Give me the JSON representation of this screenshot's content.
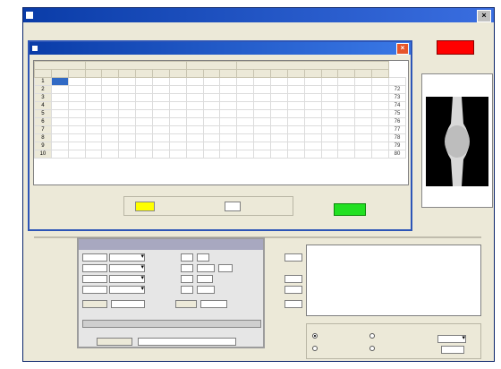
{
  "colors": {
    "title_bar": "#0a3ca8",
    "status_red": "#ff0000",
    "ok_green": "#22e022",
    "highlight_yellow": "#ffff00",
    "selection": "#316ac5"
  },
  "main_window": {
    "close_label": "×"
  },
  "dialog": {
    "close_label": "×",
    "headers": [
      "",
      "",
      "",
      "",
      "",
      "",
      "",
      "",
      "",
      "",
      "",
      "",
      "",
      "",
      "",
      "",
      "",
      "",
      "",
      "",
      ""
    ],
    "rows": [
      {
        "n": "1",
        "cells": [
          "",
          "",
          "",
          "",
          "",
          "",
          "",
          "",
          "",
          "",
          "",
          "",
          "",
          "",
          "",
          "",
          "",
          "",
          "",
          ""
        ],
        "last": ""
      },
      {
        "n": "2",
        "cells": [
          "",
          "",
          "",
          "",
          "",
          "",
          "",
          "",
          "",
          "",
          "",
          "",
          "",
          "",
          "",
          "",
          "",
          "",
          "",
          ""
        ],
        "last": "72"
      },
      {
        "n": "3",
        "cells": [
          "",
          "",
          "",
          "",
          "",
          "",
          "",
          "",
          "",
          "",
          "",
          "",
          "",
          "",
          "",
          "",
          "",
          "",
          "",
          ""
        ],
        "last": "73"
      },
      {
        "n": "4",
        "cells": [
          "",
          "",
          "",
          "",
          "",
          "",
          "",
          "",
          "",
          "",
          "",
          "",
          "",
          "",
          "",
          "",
          "",
          "",
          "",
          ""
        ],
        "last": "74"
      },
      {
        "n": "5",
        "cells": [
          "",
          "",
          "",
          "",
          "",
          "",
          "",
          "",
          "",
          "",
          "",
          "",
          "",
          "",
          "",
          "",
          "",
          "",
          "",
          ""
        ],
        "last": "75"
      },
      {
        "n": "6",
        "cells": [
          "",
          "",
          "",
          "",
          "",
          "",
          "",
          "",
          "",
          "",
          "",
          "",
          "",
          "",
          "",
          "",
          "",
          "",
          "",
          ""
        ],
        "last": "76"
      },
      {
        "n": "7",
        "cells": [
          "",
          "",
          "",
          "",
          "",
          "",
          "",
          "",
          "",
          "",
          "",
          "",
          "",
          "",
          "",
          "",
          "",
          "",
          "",
          ""
        ],
        "last": "77"
      },
      {
        "n": "8",
        "cells": [
          "",
          "",
          "",
          "",
          "",
          "",
          "",
          "",
          "",
          "",
          "",
          "",
          "",
          "",
          "",
          "",
          "",
          "",
          "",
          ""
        ],
        "last": "78"
      },
      {
        "n": "9",
        "cells": [
          "",
          "",
          "",
          "",
          "",
          "",
          "",
          "",
          "",
          "",
          "",
          "",
          "",
          "",
          "",
          "",
          "",
          "",
          "",
          ""
        ],
        "last": "79"
      },
      {
        "n": "10",
        "cells": [
          "",
          "",
          "",
          "",
          "",
          "",
          "",
          "",
          "",
          "",
          "",
          "",
          "",
          "",
          "",
          "",
          "",
          "",
          "",
          ""
        ],
        "last": "80"
      }
    ],
    "yellow_label": "",
    "bottom_input": "",
    "ok_label": ""
  },
  "form": {
    "footer_input": ""
  },
  "notes": {
    "text": ""
  }
}
